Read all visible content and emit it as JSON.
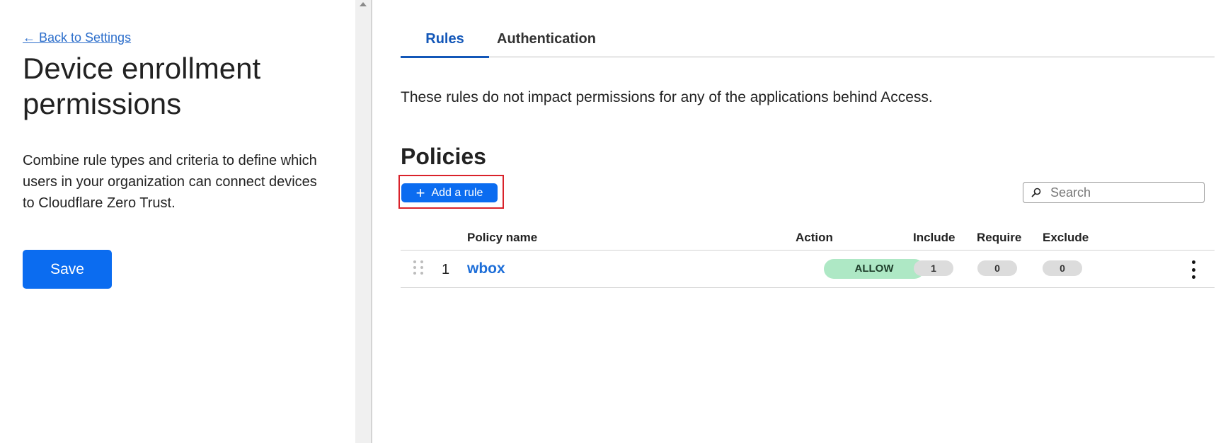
{
  "left_panel": {
    "back_link": "← Back to Settings",
    "title": "Device enrollment permissions",
    "description": "Combine rule types and criteria to define which users in your organization can connect devices to Cloudflare Zero Trust.",
    "save_label": "Save"
  },
  "tabs": [
    {
      "label": "Rules",
      "active": true
    },
    {
      "label": "Authentication",
      "active": false
    }
  ],
  "main": {
    "info_text": "These rules do not impact permissions for any of the applications behind Access.",
    "section_title": "Policies",
    "add_rule_label": "Add a rule",
    "search_placeholder": "Search"
  },
  "table": {
    "headers": {
      "policy_name": "Policy name",
      "action": "Action",
      "include": "Include",
      "require": "Require",
      "exclude": "Exclude"
    },
    "rows": [
      {
        "index": "1",
        "policy_name": "wbox",
        "action": "ALLOW",
        "include": "1",
        "require": "0",
        "exclude": "0"
      }
    ]
  },
  "colors": {
    "primary": "#0b6cf0",
    "link": "#2c6ecb",
    "allow_badge": "#aee8c5",
    "highlight": "#d9222a"
  },
  "icons": [
    "plus-icon",
    "search-icon",
    "drag-handle-icon",
    "kebab-menu-icon",
    "scroll-up-arrow-icon"
  ]
}
